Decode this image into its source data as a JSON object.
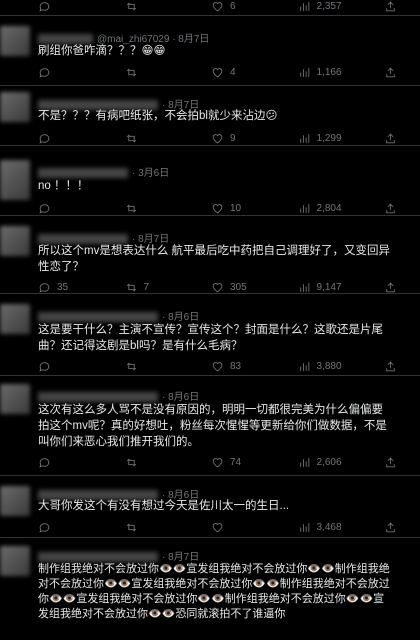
{
  "posts": [
    {
      "header": "",
      "text": "",
      "replies": "",
      "retweets": "",
      "likes": "6",
      "views": "2,357"
    },
    {
      "handle": "@mai_zhi67029",
      "time": "· 8月7日",
      "text": "刷组你爸咋滴？？？😁😁",
      "replies": "",
      "retweets": "",
      "likes": "4",
      "views": "1,166"
    },
    {
      "handle": "",
      "time": "· 8月7日",
      "text": "不是？？？有病吧纸张，不会拍bl就少来沾边😕",
      "replies": "",
      "retweets": "",
      "likes": "9",
      "views": "1,299"
    },
    {
      "handle": "",
      "time": "· 3月6日",
      "text": "no ！！！",
      "replies": "",
      "retweets": "",
      "likes": "10",
      "views": "2,804"
    },
    {
      "handle": "",
      "time": "· 8月7日",
      "text": "所以这个mv是想表达什么 航平最后吃中药把自己调理好了，又变回异性恋了？",
      "replies": "35",
      "retweets": "7",
      "likes": "305",
      "views": "9,147"
    },
    {
      "handle": "",
      "time": "· 8月6日",
      "text": "这是要干什么？主演不宣传？宣传这个？封面是什么？这歌还是片尾曲？还记得这剧是bl吗？是有什么毛病？",
      "replies": "",
      "retweets": "",
      "likes": "83",
      "views": "3,880"
    },
    {
      "handle": "",
      "time": "· 8月6日",
      "text": "这次有这么多人骂不是没有原因的，明明一切都很完美为什么偏偏要拍这个mv呢？真的好想吐，粉丝每次惺惺等更新给你们做数据，不是叫你们来恶心我们推开我们的。",
      "replies": "",
      "retweets": "",
      "likes": "74",
      "views": "2,606"
    },
    {
      "handle": "",
      "time": "· 8月6日",
      "text": "大哥你发这个有没有想过今天是佐川太一的生日...",
      "replies": "",
      "retweets": "",
      "likes": "",
      "views": "3,468"
    },
    {
      "handle": "",
      "time": "· 8月7日",
      "text": "制作组我绝对不会放过你👁️👁️宣发组我绝对不会放过你👁️👁️制作组我绝对不会放过你👁️👁️宣发组我绝对不会放过你👁️👁️制作组我绝对不会放过你👁️👁️宣发组我绝对不会放过你👁️👁️制作组我绝对不会放过你👁️👁️宣发组我绝对不会放过你👁️👁️恐同就滚拍不了谁逼你",
      "replies": "",
      "retweets": "",
      "likes": "",
      "views": ""
    }
  ]
}
